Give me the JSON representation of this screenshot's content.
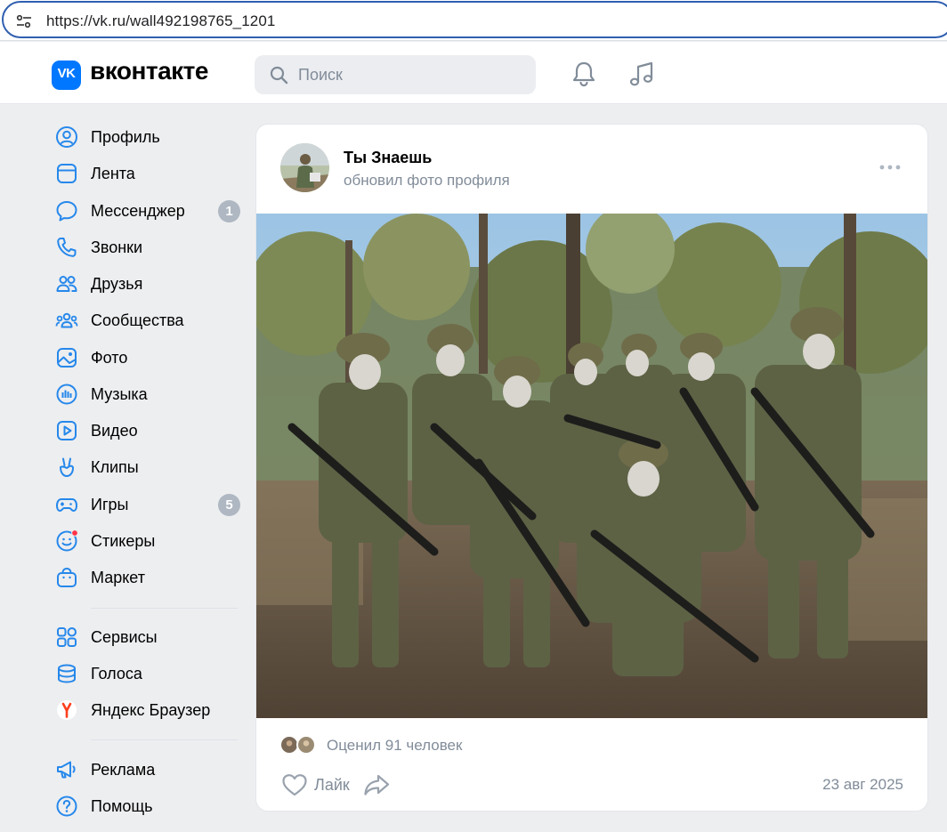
{
  "browser": {
    "url": "https://vk.ru/wall492198765_1201"
  },
  "header": {
    "logo_mark": "VK",
    "logo_text": "вконтакте",
    "search_placeholder": "Поиск",
    "icons": [
      "bell-icon",
      "music-note-icon"
    ]
  },
  "sidebar": {
    "items": [
      {
        "label": "Профиль",
        "icon": "profile-icon"
      },
      {
        "label": "Лента",
        "icon": "feed-icon"
      },
      {
        "label": "Мессенджер",
        "icon": "messenger-icon",
        "badge": "1"
      },
      {
        "label": "Звонки",
        "icon": "phone-icon"
      },
      {
        "label": "Друзья",
        "icon": "friends-icon"
      },
      {
        "label": "Сообщества",
        "icon": "communities-icon"
      },
      {
        "label": "Фото",
        "icon": "photo-icon"
      },
      {
        "label": "Музыка",
        "icon": "music-icon"
      },
      {
        "label": "Видео",
        "icon": "video-icon"
      },
      {
        "label": "Клипы",
        "icon": "clips-icon"
      },
      {
        "label": "Игры",
        "icon": "games-icon",
        "badge": "5"
      },
      {
        "label": "Стикеры",
        "icon": "stickers-icon"
      },
      {
        "label": "Маркет",
        "icon": "market-icon"
      },
      {
        "label": "Сервисы",
        "icon": "services-icon"
      },
      {
        "label": "Голоса",
        "icon": "votes-icon"
      },
      {
        "label": "Яндекс Браузер",
        "icon": "yandex-browser-icon"
      },
      {
        "label": "Реклама",
        "icon": "megaphone-icon"
      },
      {
        "label": "Помощь",
        "icon": "help-icon"
      }
    ]
  },
  "post": {
    "author": "Ты Знаешь",
    "action": "обновил фото профиля",
    "likes_text": "Оценил 91 человек",
    "like_label": "Лайк",
    "date": "23 авг 2025"
  },
  "colors": {
    "accent": "#0077ff",
    "secondary_text": "#818c99",
    "badge": "#aeb7c2",
    "icon": "#2688eb",
    "background": "#edeef0"
  }
}
